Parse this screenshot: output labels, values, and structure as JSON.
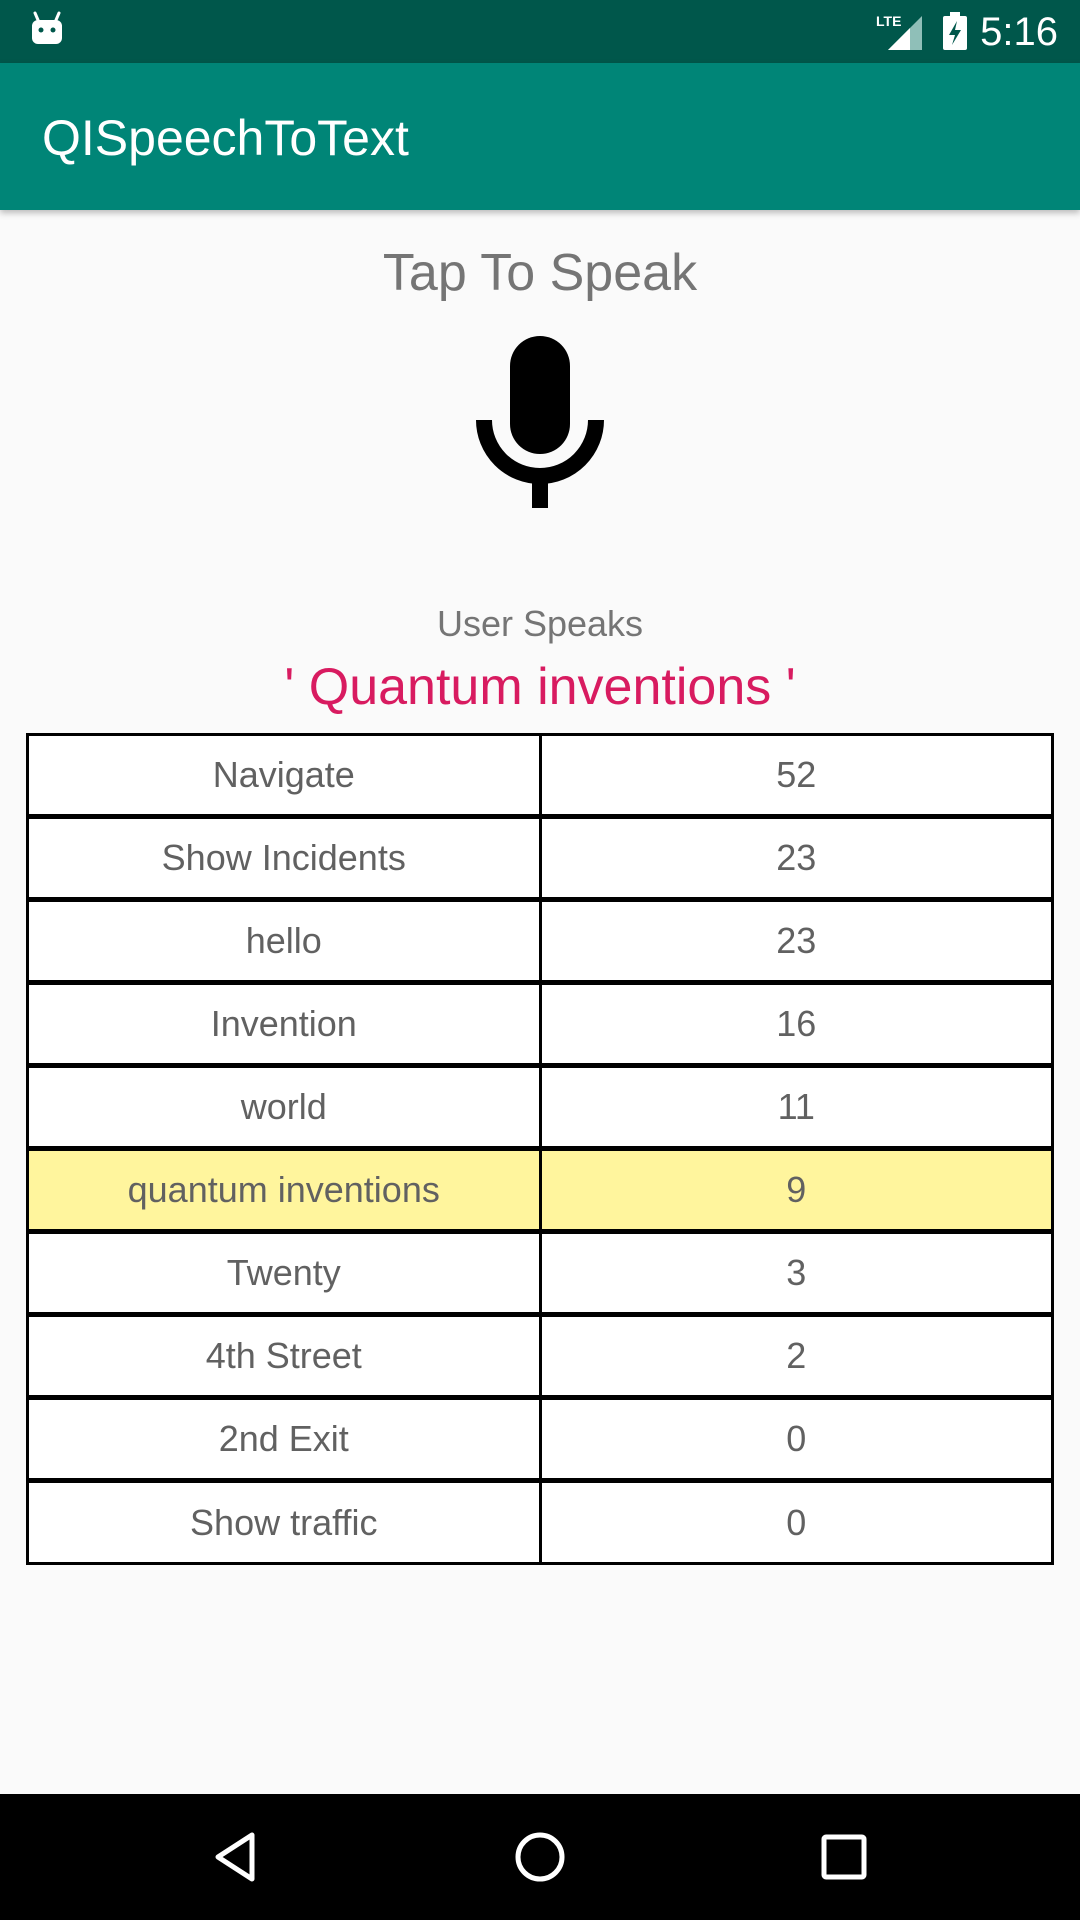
{
  "status_bar": {
    "time": "5:16",
    "network_label": "LTE",
    "icons": [
      "android-icon",
      "lte-signal-icon",
      "battery-charging-icon"
    ]
  },
  "app_bar": {
    "title": "QISpeechToText",
    "color": "#008577",
    "status_color": "#00574b"
  },
  "main": {
    "tap_label": "Tap To Speak",
    "mic_icon": "microphone-icon",
    "user_speaks_label": "User Speaks",
    "spoken_text": "' Quantum inventions '",
    "spoken_color": "#d81b60"
  },
  "table": {
    "highlight_color": "#fff59d",
    "highlight_index": 5,
    "rows": [
      {
        "phrase": "Navigate",
        "score": "52"
      },
      {
        "phrase": "Show Incidents",
        "score": "23"
      },
      {
        "phrase": "hello",
        "score": "23"
      },
      {
        "phrase": "Invention",
        "score": "16"
      },
      {
        "phrase": "world",
        "score": "11"
      },
      {
        "phrase": "quantum inventions",
        "score": "9"
      },
      {
        "phrase": "Twenty",
        "score": "3"
      },
      {
        "phrase": "4th Street",
        "score": "2"
      },
      {
        "phrase": "2nd Exit",
        "score": "0"
      },
      {
        "phrase": "Show traffic",
        "score": "0"
      }
    ]
  },
  "nav_bar": {
    "buttons": [
      "back-icon",
      "home-icon",
      "recents-icon"
    ]
  }
}
